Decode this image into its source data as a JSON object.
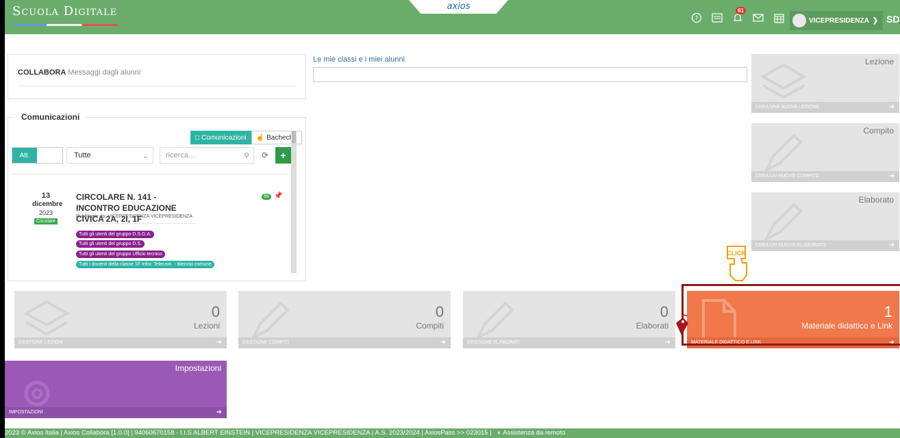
{
  "header": {
    "brand": "Scuola Digitale",
    "center_logo": "axios",
    "notifications_count": "61",
    "user": "VICEPRESIDENZA",
    "initials": "SD",
    "icons": [
      "help-icon",
      "register-icon",
      "bell-icon",
      "mail-icon",
      "calendar-icon"
    ]
  },
  "collabora": {
    "title": "COLLABORA",
    "subtitle": "Messaggi dagli alunni"
  },
  "classi": {
    "label": "Le mie classi e i miei alunni"
  },
  "comunicazioni": {
    "title": "Comunicazioni",
    "tab_active": "Comunicazioni",
    "tab_other": "Bacheche",
    "att_label": "Att.",
    "filter_value": "Tutte",
    "search_placeholder": "ricerca...",
    "item": {
      "day": "13",
      "month": "dicembre",
      "year": "2023",
      "type": "Circolare",
      "title": "CIRCOLARE N. 141 - INCONTRO EDUCAZIONE CIVICA 2A, 2I, 1F",
      "published_by": "Pubblicata da: VICEPRESIDENZA VICEPRESIDENZA",
      "views": "99",
      "tags": [
        "Tutti gli utenti del gruppo D.S.G.A.",
        "Tutti gli utenti del gruppo D.S.",
        "Tutti gli utenti del gruppo Ufficio tecnico",
        "Tutti i docenti della classe 1F Infor. Telecom. - Biennio comune"
      ]
    }
  },
  "side_tiles": [
    {
      "name": "Lezione",
      "action": "CREA UNA NUOVA LEZIONE"
    },
    {
      "name": "Compito",
      "action": "CREA UN NUOVO COMPITO"
    },
    {
      "name": "Elaborato",
      "action": "CREA UN NUOVO ELABORATO"
    }
  ],
  "bottom_tiles": [
    {
      "count": "0",
      "label": "Lezioni",
      "action": "GESTIONE LEZIONI"
    },
    {
      "count": "0",
      "label": "Compiti",
      "action": "GESTIONE COMPITI"
    },
    {
      "count": "0",
      "label": "Elaborati",
      "action": "GESTIONE ELABORATI"
    },
    {
      "count": "1",
      "label": "Materiale didattico e Link",
      "action": "MATERIALE DIDATTICO E LINK"
    }
  ],
  "settings_tile": {
    "name": "Impostazioni",
    "action": "IMPOSTAZIONI"
  },
  "annotation": {
    "click_label": "CLICK"
  },
  "footer": {
    "text": "2023 © Axios Italia | Axios Collabora [1.0.0] | 94060670158 - I.I.S ALBERT EINSTEIN | VICEPRESIDENZA VICEPRESIDENZA | A.S. 2023/2024 | AxiosPass >> 023015 |",
    "assist": "Assistenza da remoto"
  },
  "colors": {
    "topbar": "#6aad6b",
    "teal": "#2fb3a3",
    "orange": "#f0784b",
    "purple": "#9b59b6",
    "highlight": "#8b1a1a"
  }
}
